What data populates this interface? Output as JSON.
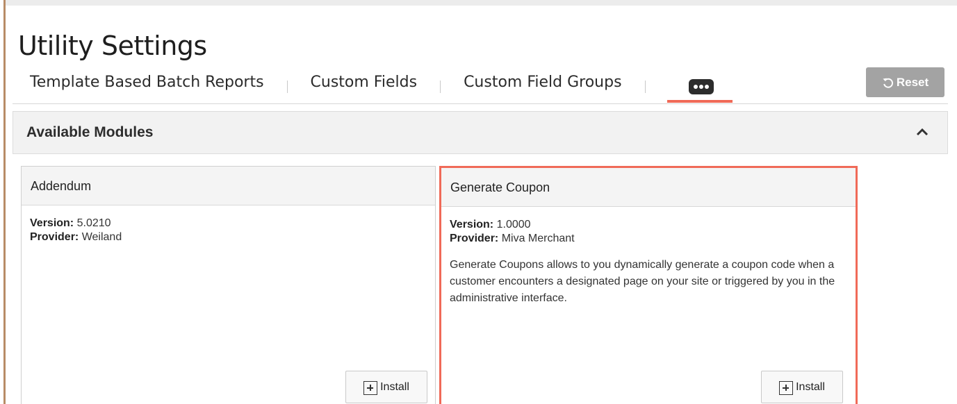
{
  "page": {
    "title": "Utility Settings"
  },
  "tabs": [
    {
      "label": "Template Based Batch Reports"
    },
    {
      "label": "Custom Fields"
    },
    {
      "label": "Custom Field Groups"
    }
  ],
  "more_tab": {
    "icon": "ellipsis-icon",
    "active": true
  },
  "reset": {
    "label": "Reset",
    "icon": "reset-icon"
  },
  "section": {
    "title": "Available Modules",
    "collapse_icon": "chevron-up-icon"
  },
  "modules": [
    {
      "name": "Addendum",
      "version_label": "Version:",
      "version": "5.0210",
      "provider_label": "Provider:",
      "provider": "Weiland",
      "description": "",
      "install_label": "Install"
    },
    {
      "name": "Generate Coupon",
      "version_label": "Version:",
      "version": "1.0000",
      "provider_label": "Provider:",
      "provider": "Miva Merchant",
      "description": "Generate Coupons allows to you dynamically generate a coupon code when a customer encounters a designated page on your site or triggered by you in the administrative interface.",
      "install_label": "Install"
    }
  ],
  "colors": {
    "accent": "#f06a58",
    "reset_bg": "#a3a3a3",
    "section_bg": "#f2f2f2"
  }
}
